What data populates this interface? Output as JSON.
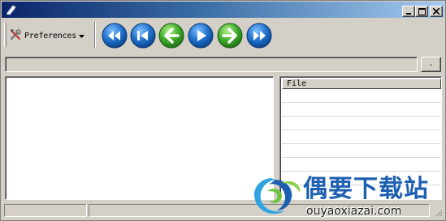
{
  "toolbar": {
    "preferences_label": "Preferences",
    "nav_buttons": [
      {
        "name": "rewind",
        "color": "#1f6fc9"
      },
      {
        "name": "skip-to-start",
        "color": "#1f6fc9"
      },
      {
        "name": "back-arrow",
        "color": "#3caa2a"
      },
      {
        "name": "play",
        "color": "#1f6fc9"
      },
      {
        "name": "forward-arrow",
        "color": "#3caa2a"
      },
      {
        "name": "fast-forward",
        "color": "#1f6fc9"
      }
    ]
  },
  "path_bar": {
    "value": "",
    "browse_label": "."
  },
  "file_list": {
    "column_header": "File"
  },
  "watermark": {
    "title": "偶要下载站",
    "url": "ouyaoxiazai.com"
  },
  "colors": {
    "titlebar_start": "#0a246a",
    "titlebar_end": "#a6caf0",
    "face": "#d4d0c8"
  }
}
